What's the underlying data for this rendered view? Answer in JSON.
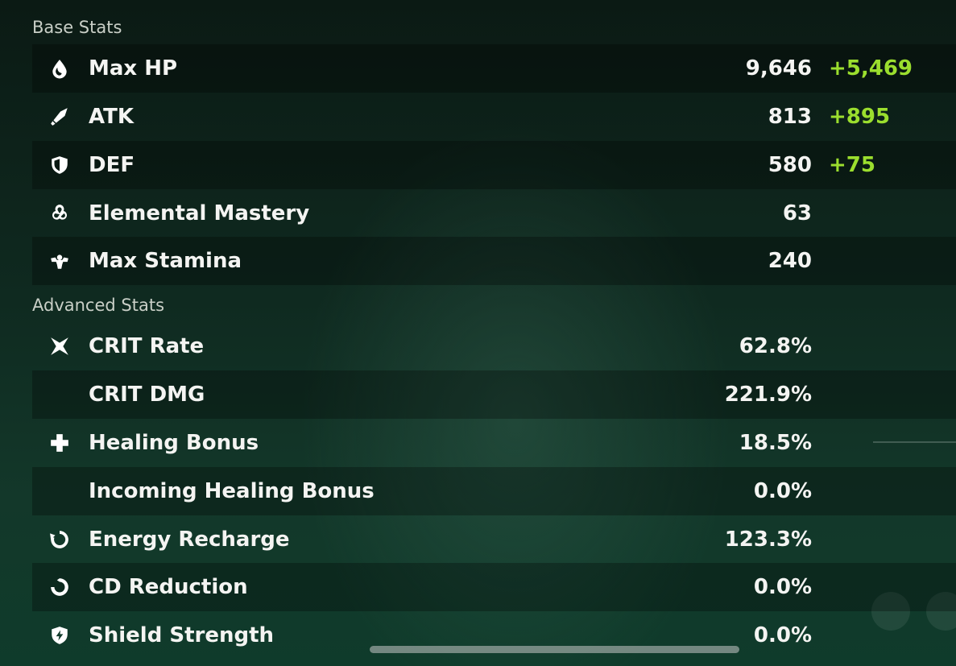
{
  "base_stats": {
    "title": "Base Stats",
    "rows": [
      {
        "label": "Max HP",
        "value": "9,646",
        "bonus": "+5,469",
        "icon": "hp-drop-icon"
      },
      {
        "label": "ATK",
        "value": "813",
        "bonus": "+895",
        "icon": "sword-icon"
      },
      {
        "label": "DEF",
        "value": "580",
        "bonus": "+75",
        "icon": "shield-icon"
      },
      {
        "label": "Elemental Mastery",
        "value": "63",
        "bonus": "",
        "icon": "elemental-mastery-icon"
      },
      {
        "label": "Max Stamina",
        "value": "240",
        "bonus": "",
        "icon": "stamina-icon"
      }
    ]
  },
  "advanced_stats": {
    "title": "Advanced Stats",
    "rows": [
      {
        "label": "CRIT Rate",
        "value": "62.8%",
        "icon": "crit-rate-icon"
      },
      {
        "label": "CRIT DMG",
        "value": "221.9%",
        "icon": ""
      },
      {
        "label": "Healing Bonus",
        "value": "18.5%",
        "icon": "healing-cross-icon"
      },
      {
        "label": "Incoming Healing Bonus",
        "value": "0.0%",
        "icon": ""
      },
      {
        "label": "Energy Recharge",
        "value": "123.3%",
        "icon": "energy-recharge-icon"
      },
      {
        "label": "CD Reduction",
        "value": "0.0%",
        "icon": "cd-reduction-icon"
      },
      {
        "label": "Shield Strength",
        "value": "0.0%",
        "icon": "shield-strength-icon"
      }
    ]
  },
  "colors": {
    "bonus": "#9bde2e",
    "text": "#f4f4f2",
    "section": "#c9cfc7"
  }
}
